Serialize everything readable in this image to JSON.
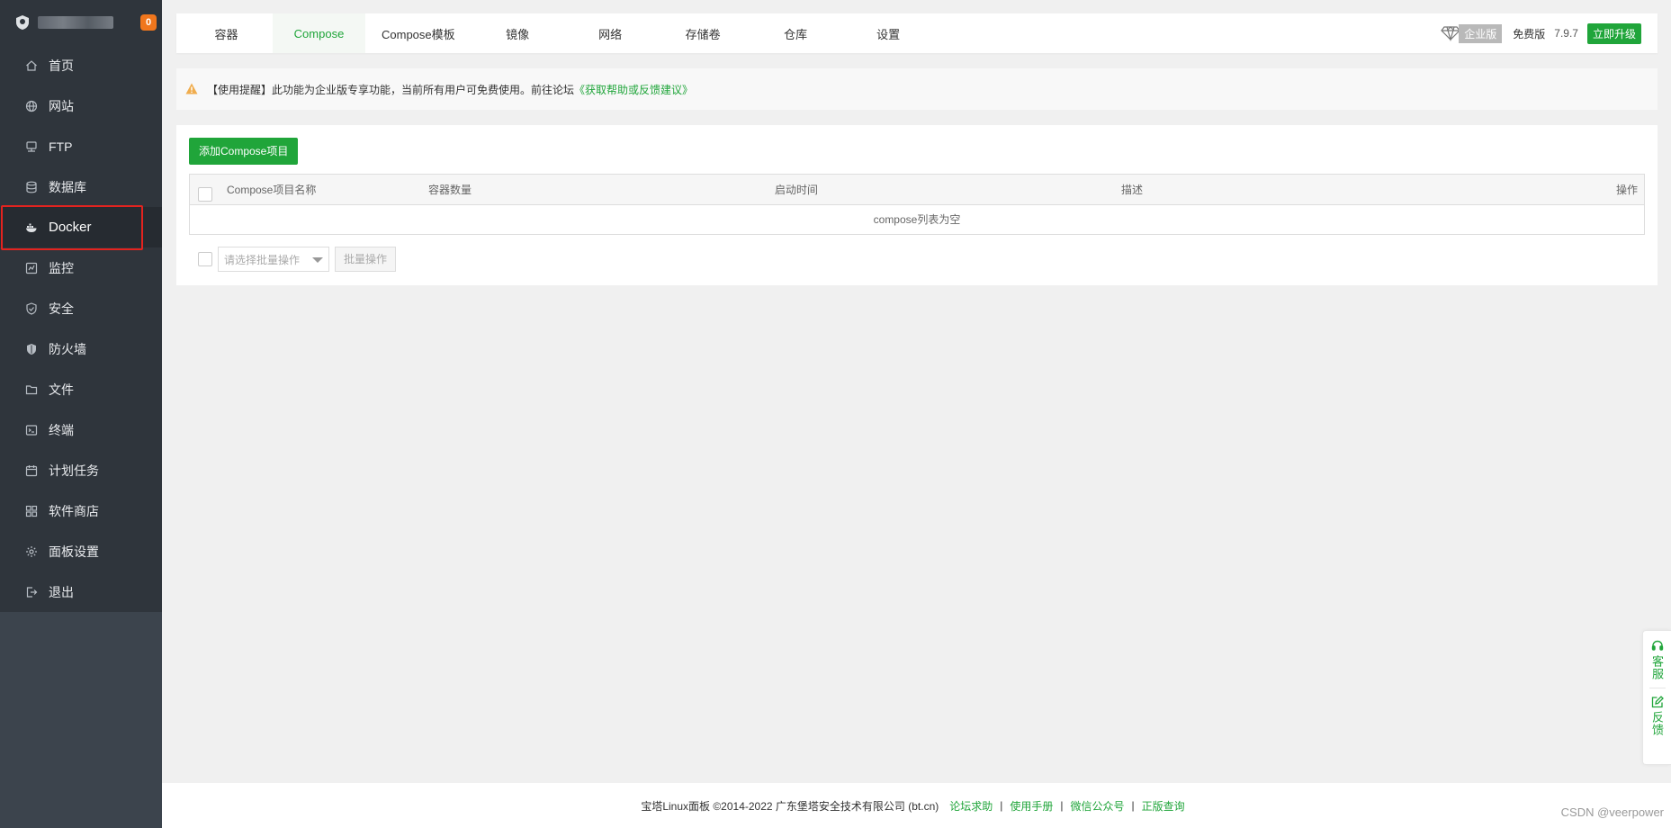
{
  "sidebar": {
    "badge": "0",
    "items": [
      {
        "label": "首页",
        "icon": "home-icon"
      },
      {
        "label": "网站",
        "icon": "globe-icon"
      },
      {
        "label": "FTP",
        "icon": "ftp-icon"
      },
      {
        "label": "数据库",
        "icon": "database-icon"
      },
      {
        "label": "Docker",
        "icon": "docker-icon"
      },
      {
        "label": "监控",
        "icon": "monitor-icon"
      },
      {
        "label": "安全",
        "icon": "shield-icon"
      },
      {
        "label": "防火墙",
        "icon": "firewall-icon"
      },
      {
        "label": "文件",
        "icon": "folder-icon"
      },
      {
        "label": "终端",
        "icon": "terminal-icon"
      },
      {
        "label": "计划任务",
        "icon": "calendar-icon"
      },
      {
        "label": "软件商店",
        "icon": "grid-icon"
      },
      {
        "label": "面板设置",
        "icon": "gear-icon"
      },
      {
        "label": "退出",
        "icon": "logout-icon"
      }
    ]
  },
  "tabs": [
    "容器",
    "Compose",
    "Compose模板",
    "镜像",
    "网络",
    "存储卷",
    "仓库",
    "设置"
  ],
  "header": {
    "enterprise": "企业版",
    "free": "免费版",
    "version": "7.9.7",
    "upgrade": "立即升级"
  },
  "notice": {
    "text": "【使用提醒】此功能为企业版专享功能，当前所有用户可免费使用。前往论坛",
    "link": "《获取帮助或反馈建议》"
  },
  "main": {
    "add_button": "添加Compose项目",
    "columns": {
      "name": "Compose项目名称",
      "count": "容器数量",
      "start_time": "启动时间",
      "desc": "描述",
      "ops": "操作"
    },
    "empty": "compose列表为空",
    "batch_placeholder": "请选择批量操作",
    "batch_button": "批量操作"
  },
  "footer": {
    "copyright": "宝塔Linux面板 ©2014-2022 广东堡塔安全技术有限公司 (bt.cn)",
    "links": [
      "论坛求助",
      "使用手册",
      "微信公众号",
      "正版查询"
    ]
  },
  "float": {
    "service": "客服",
    "feedback": "反馈"
  },
  "watermark": "CSDN @veerpower",
  "colors": {
    "accent": "#20a53a",
    "sidebar_bg": "#2f353c",
    "badge": "#f0761d",
    "highlight": "#e3231f"
  }
}
